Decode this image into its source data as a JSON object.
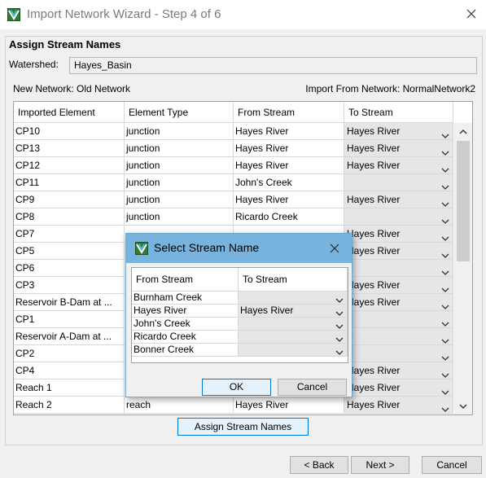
{
  "window": {
    "title": "Import Network Wizard - Step 4 of 6"
  },
  "panel": {
    "title": "Assign Stream Names",
    "watershed_label": "Watershed:",
    "watershed_value": "Hayes_Basin",
    "new_network": "New Network: Old Network",
    "import_from": "Import From Network: NormalNetwork2"
  },
  "table": {
    "columns": [
      "Imported Element",
      "Element Type",
      "From Stream",
      "To Stream"
    ],
    "rows": [
      {
        "element": "CP10",
        "type": "junction",
        "from": "Hayes River",
        "to": "Hayes River"
      },
      {
        "element": "CP13",
        "type": "junction",
        "from": "Hayes River",
        "to": "Hayes River"
      },
      {
        "element": "CP12",
        "type": "junction",
        "from": "Hayes River",
        "to": "Hayes River"
      },
      {
        "element": "CP11",
        "type": "junction",
        "from": "John's Creek",
        "to": ""
      },
      {
        "element": "CP9",
        "type": "junction",
        "from": "Hayes River",
        "to": "Hayes River"
      },
      {
        "element": "CP8",
        "type": "junction",
        "from": "Ricardo Creek",
        "to": ""
      },
      {
        "element": "CP7",
        "type": "",
        "from": "",
        "to": "Hayes River"
      },
      {
        "element": "CP5",
        "type": "",
        "from": "",
        "to": "Hayes River"
      },
      {
        "element": "CP6",
        "type": "",
        "from": "",
        "to": ""
      },
      {
        "element": "CP3",
        "type": "",
        "from": "",
        "to": "Hayes River"
      },
      {
        "element": "Reservoir B-Dam at ...",
        "type": "",
        "from": "",
        "to": "Hayes River"
      },
      {
        "element": "CP1",
        "type": "",
        "from": "",
        "to": ""
      },
      {
        "element": "Reservoir A-Dam at ...",
        "type": "",
        "from": "",
        "to": ""
      },
      {
        "element": "CP2",
        "type": "",
        "from": "",
        "to": ""
      },
      {
        "element": "CP4",
        "type": "",
        "from": "",
        "to": "Hayes River"
      },
      {
        "element": "Reach 1",
        "type": "",
        "from": "",
        "to": "Hayes River"
      },
      {
        "element": "Reach 2",
        "type": "reach",
        "from": "Hayes River",
        "to": "Hayes River"
      }
    ]
  },
  "assign_button": "Assign Stream Names",
  "footer": {
    "back": "< Back",
    "next": "Next >",
    "cancel": "Cancel"
  },
  "dialog": {
    "title": "Select Stream Name",
    "columns": [
      "From Stream",
      "To Stream"
    ],
    "rows": [
      {
        "from": "Burnham Creek",
        "to": ""
      },
      {
        "from": "Hayes River",
        "to": "Hayes River"
      },
      {
        "from": "John's Creek",
        "to": ""
      },
      {
        "from": "Ricardo Creek",
        "to": ""
      },
      {
        "from": "Bonner Creek",
        "to": ""
      }
    ],
    "ok": "OK",
    "cancel": "Cancel"
  },
  "colors": {
    "accent": "#0078d7",
    "dialog_titlebar": "#77b3dc",
    "selected_cell": "#e6e6e6"
  },
  "icons": {
    "app": "network-wizard-icon",
    "close": "close-icon",
    "dropdown": "chevron-down-icon"
  }
}
